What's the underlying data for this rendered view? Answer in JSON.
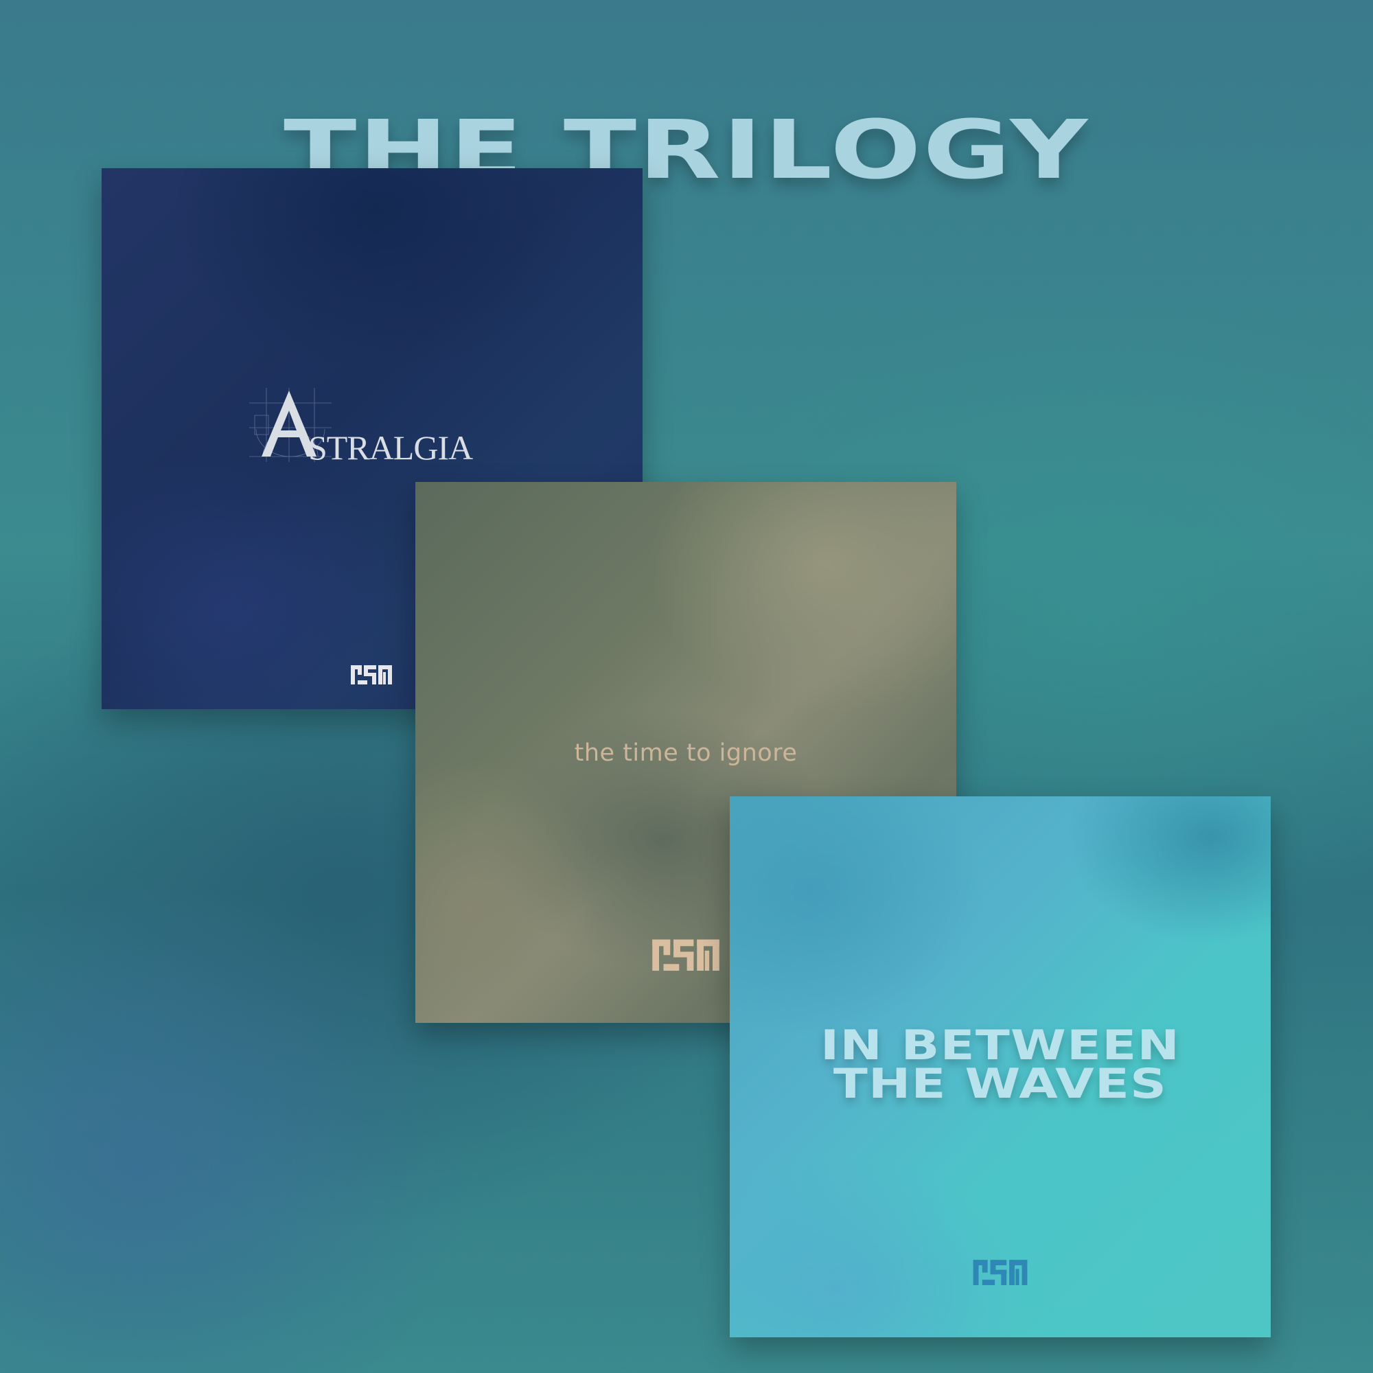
{
  "page": {
    "title": "THE TRILOGY",
    "title_color": "#a9d3df"
  },
  "covers": [
    {
      "name": "astralgia",
      "initial": "A",
      "rest": "STRALGIA",
      "text_color": "#d9dde4",
      "mark_color": "#e6e8ee",
      "background_color": "#1f3363"
    },
    {
      "name": "time",
      "title": "the time to ignore",
      "text_color": "#cdb59a",
      "mark_color": "#d9bea0",
      "background_color": "#6f7a65"
    },
    {
      "name": "waves",
      "title_line1": "IN BETWEEN",
      "title_line2": "THE WAVES",
      "text_color": "#b9e3ec",
      "mark_color": "#2f87b5",
      "background_color": "#4fbfca"
    }
  ]
}
